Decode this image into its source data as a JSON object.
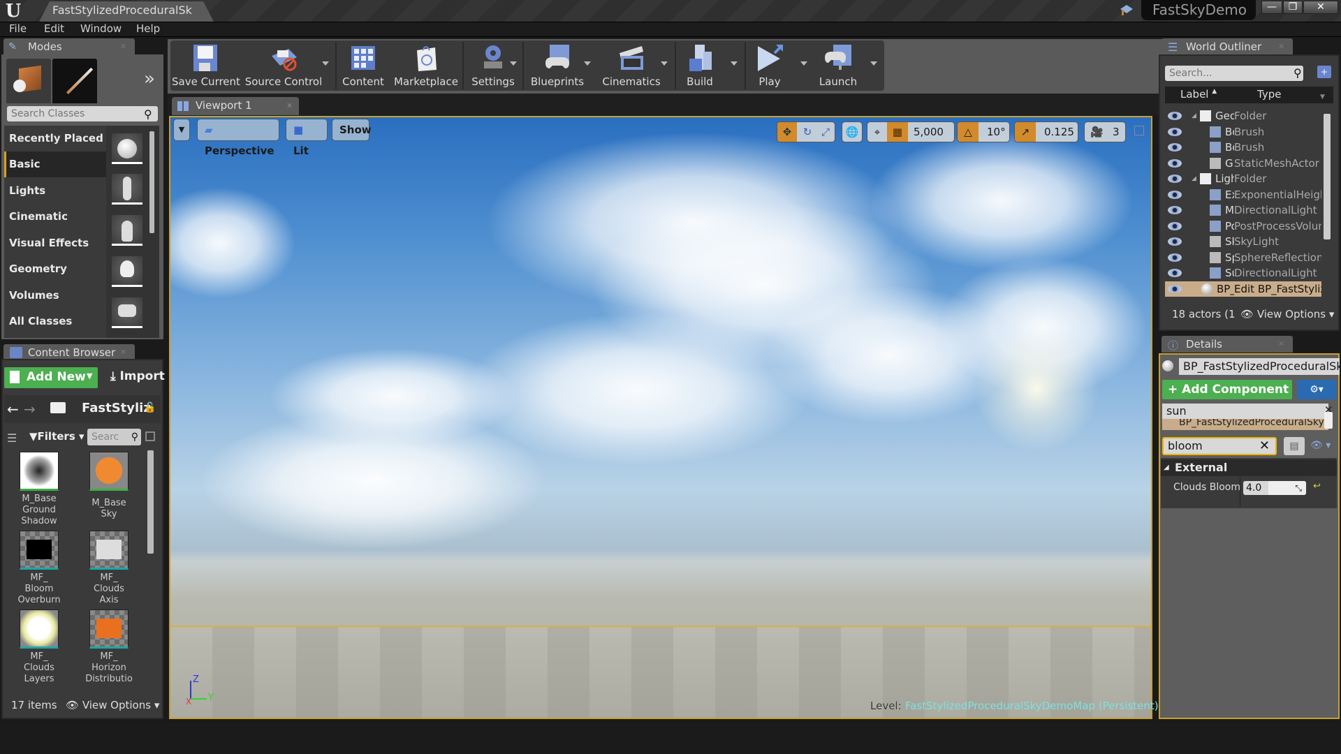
{
  "window": {
    "document_tab": "FastStylizedProceduralSkyD",
    "project_name": "FastSkyDemo",
    "controls": {
      "minimize": "—",
      "restore": "❐",
      "close": "✕"
    }
  },
  "menu": [
    "File",
    "Edit",
    "Window",
    "Help"
  ],
  "modes": {
    "tab_label": "Modes",
    "search_placeholder": "Search Classes",
    "categories": [
      "Recently Placed",
      "Basic",
      "Lights",
      "Cinematic",
      "Visual Effects",
      "Geometry",
      "Volumes",
      "All Classes"
    ],
    "selected_category": "Basic",
    "placeable_icons": [
      "sphere-icon",
      "character-icon",
      "pawn-icon",
      "point-light-icon",
      "player-start-icon"
    ]
  },
  "content_browser": {
    "tab_label": "Content Browser",
    "add_new": "Add New",
    "import": "Import",
    "path": "FastStyliz",
    "filters": "Filters",
    "search_placeholder": "Searc",
    "items": [
      {
        "lines": [
          "M_Base",
          "Ground",
          "Shadow"
        ],
        "thumb": "material-ground-shadow",
        "accent": "#3cb043"
      },
      {
        "lines": [
          "M_Base",
          "Sky"
        ],
        "thumb": "material-sky",
        "accent": "#3cb043"
      },
      {
        "lines": [
          "MF_",
          "Bloom",
          "Overburn"
        ],
        "thumb": "function-black",
        "accent": "#1fa5a8"
      },
      {
        "lines": [
          "MF_",
          "Clouds",
          "Axis"
        ],
        "thumb": "function-white",
        "accent": "#1fa5a8"
      },
      {
        "lines": [
          "MF_",
          "Clouds",
          "Layers"
        ],
        "thumb": "function-glow",
        "accent": "#1fa5a8"
      },
      {
        "lines": [
          "MF_",
          "Horizon",
          "Distributio"
        ],
        "thumb": "function-orange",
        "accent": "#1fa5a8"
      }
    ],
    "item_count": "17 items",
    "view_options": "View Options"
  },
  "toolbar": {
    "buttons": [
      {
        "label": "Save Current",
        "icon": "save-icon",
        "dropdown": false
      },
      {
        "label": "Source Control",
        "icon": "source-control-icon",
        "dropdown": true
      },
      {
        "label": "Content",
        "icon": "content-icon",
        "dropdown": false
      },
      {
        "label": "Marketplace",
        "icon": "marketplace-icon",
        "dropdown": false
      },
      {
        "label": "Settings",
        "icon": "settings-icon",
        "dropdown": true
      },
      {
        "label": "Blueprints",
        "icon": "blueprints-icon",
        "dropdown": true
      },
      {
        "label": "Cinematics",
        "icon": "cinematics-icon",
        "dropdown": true
      },
      {
        "label": "Build",
        "icon": "build-icon",
        "dropdown": true
      },
      {
        "label": "Play",
        "icon": "play-icon",
        "dropdown": true
      },
      {
        "label": "Launch",
        "icon": "launch-icon",
        "dropdown": true
      }
    ]
  },
  "viewport": {
    "tab_label": "Viewport 1",
    "view_mode": "Perspective",
    "lighting": "Lit",
    "show": "Show",
    "grid_snap": "5,000",
    "rotation_snap": "10°",
    "scale_snap": "0.125",
    "camera_speed": "3",
    "level_label": "Level:",
    "level_name": "FastStylizedProceduralSkyDemoMap (Persistent)",
    "axes": {
      "z": "Z",
      "y": "Y",
      "x": "X"
    }
  },
  "world_outliner": {
    "tab_label": "World Outliner",
    "search_placeholder": "Search...",
    "columns": {
      "label": "Label",
      "type": "Type"
    },
    "rows": [
      {
        "label": "Geometry",
        "type": "Folder",
        "indent": 1,
        "icon": "folder-icon",
        "expandable": true
      },
      {
        "label": "BoxBrush",
        "type": "Brush",
        "indent": 2,
        "icon": "brush-icon"
      },
      {
        "label": "BoxBrush",
        "type": "Brush",
        "indent": 2,
        "icon": "brush-icon"
      },
      {
        "label": "Ground",
        "type": "StaticMeshActor",
        "indent": 2,
        "icon": "static-mesh-icon"
      },
      {
        "label": "Lighting",
        "type": "Folder",
        "indent": 1,
        "icon": "folder-icon",
        "expandable": true
      },
      {
        "label": "ExponentialHeightFog",
        "type": "ExponentialHeightFog",
        "indent": 2,
        "icon": "fog-icon"
      },
      {
        "label": "Moon",
        "type": "DirectionalLight",
        "indent": 2,
        "icon": "directional-light-icon"
      },
      {
        "label": "PostProcessVolume",
        "type": "PostProcessVolume",
        "indent": 2,
        "icon": "post-process-icon"
      },
      {
        "label": "SkyLight",
        "type": "SkyLight",
        "indent": 2,
        "icon": "sky-light-icon"
      },
      {
        "label": "SphereReflectionCapture",
        "type": "SphereReflectionCapture",
        "indent": 2,
        "icon": "reflection-capture-icon"
      },
      {
        "label": "Sun",
        "type": "DirectionalLight",
        "indent": 2,
        "icon": "directional-light-icon"
      },
      {
        "label": "BP_FastStylizedProceduralSky",
        "type": "Edit BP_FastStylizedProceduralSky",
        "indent": 1,
        "icon": "blueprint-actor-icon",
        "selected": true
      }
    ],
    "actor_count": "18 actors (1",
    "view_options": "View Options"
  },
  "details": {
    "tab_label": "Details",
    "object_name": "BP_FastStylizedProceduralSky",
    "add_component": "Add Component",
    "component_search": "sun",
    "component_row": "BP_FastStylizedProceduralSky",
    "property_search": "bloom",
    "category": "External",
    "properties": [
      {
        "name": "Clouds Bloom",
        "value": "4.0"
      }
    ]
  },
  "colors": {
    "accent_orange": "#d18a2c",
    "selection_yellow": "#c8a030",
    "add_green": "#4caf50",
    "level_cyan": "#7fe0e0"
  }
}
